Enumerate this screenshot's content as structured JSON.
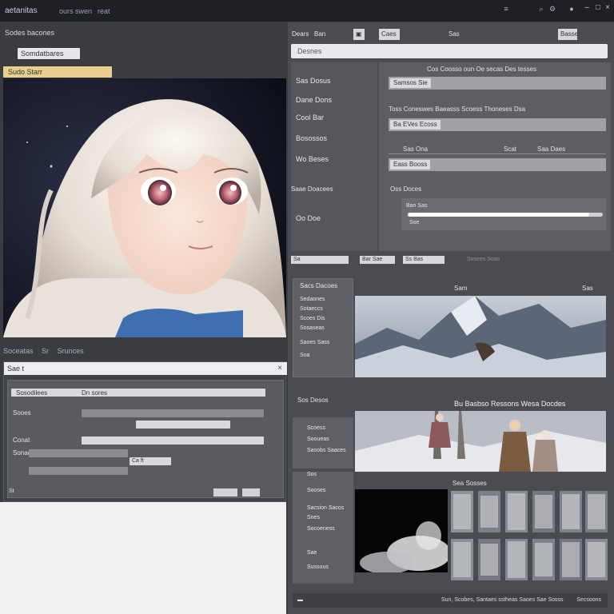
{
  "window": {
    "title": "aetanitas",
    "subtitle": "ours swen",
    "subtitle2": "reat"
  },
  "left_panel": {
    "heading": "Sodes bacones",
    "field_text": "Somdatbares",
    "highlight_text": "Sudo Starr",
    "toolbar": [
      "Soceatas",
      "Sr",
      "Srunces"
    ],
    "form": {
      "header": "Sae t",
      "rows": [
        {
          "label": "Sosodilees",
          "value": "Dn sores"
        },
        {
          "label": "Sooes",
          "value": ""
        },
        {
          "label": "Conat",
          "value": ""
        },
        {
          "label": "Sonaces",
          "value": ""
        },
        {
          "label": "",
          "value": "Ca ft"
        }
      ],
      "footer_label": "St"
    }
  },
  "right_panel": {
    "tabs": [
      "Dears",
      "Ban",
      "Caes",
      "Sas",
      "Basse"
    ],
    "url": "Desnes",
    "nav": [
      "Sas Dosus",
      "Dane Dons",
      "Cool Bar",
      "Bosossos",
      "Wo Beses",
      "Oo Doe"
    ],
    "settings": {
      "row1_label": "Cos Coosso oun Oe secas Des tesses",
      "chip1": "Samsos Sie",
      "row2_label": "Toss Coneswes Baeasss Scoess Thoneses Dsa",
      "chip2": "Ba EVes Ecoss",
      "row3_labels": [
        "Sas Ona",
        "Scat",
        "Saa Daes"
      ],
      "chip3": "Eass Booss",
      "row4_label": "Saae Doacees",
      "row4_value": "Oss Doces",
      "slider_label": "Ban Sas",
      "slider_value": "Soe",
      "slider_fill": 0.93
    },
    "status": [
      "Sa",
      "Bar Sae",
      "Ss Bas",
      "Sosees Soas"
    ],
    "gallery": {
      "nav_title": "Sacs Dacoes",
      "nav_items": [
        "Sedaones",
        "Sotaeccs",
        "Scoes Dis",
        "Sosaseas",
        "Saoes Sass",
        "Soa"
      ],
      "label1": "Sam",
      "label1_right": "Sas",
      "label2": "Sos Desos",
      "headline": "Bu Basbso Ressons Wesa Docdes",
      "nav2_items": [
        "Scoess",
        "Sooueas",
        "Sasobs Saaces"
      ],
      "label3": "Sea Sosses",
      "nav3_items": [
        "Sos",
        "Sooses",
        "Sacsion Sacos",
        "Snes",
        "Socoeness",
        "Sae",
        "Sussous"
      ],
      "bottom_text": "Sun, Scobes, Santaes sstheas Saoes Sae Sosss",
      "bottom_right": "Secsoons"
    }
  },
  "colors": {
    "background": "#2b2d33",
    "panel": "#4a4c52",
    "highlight": "#e8cf8e"
  }
}
